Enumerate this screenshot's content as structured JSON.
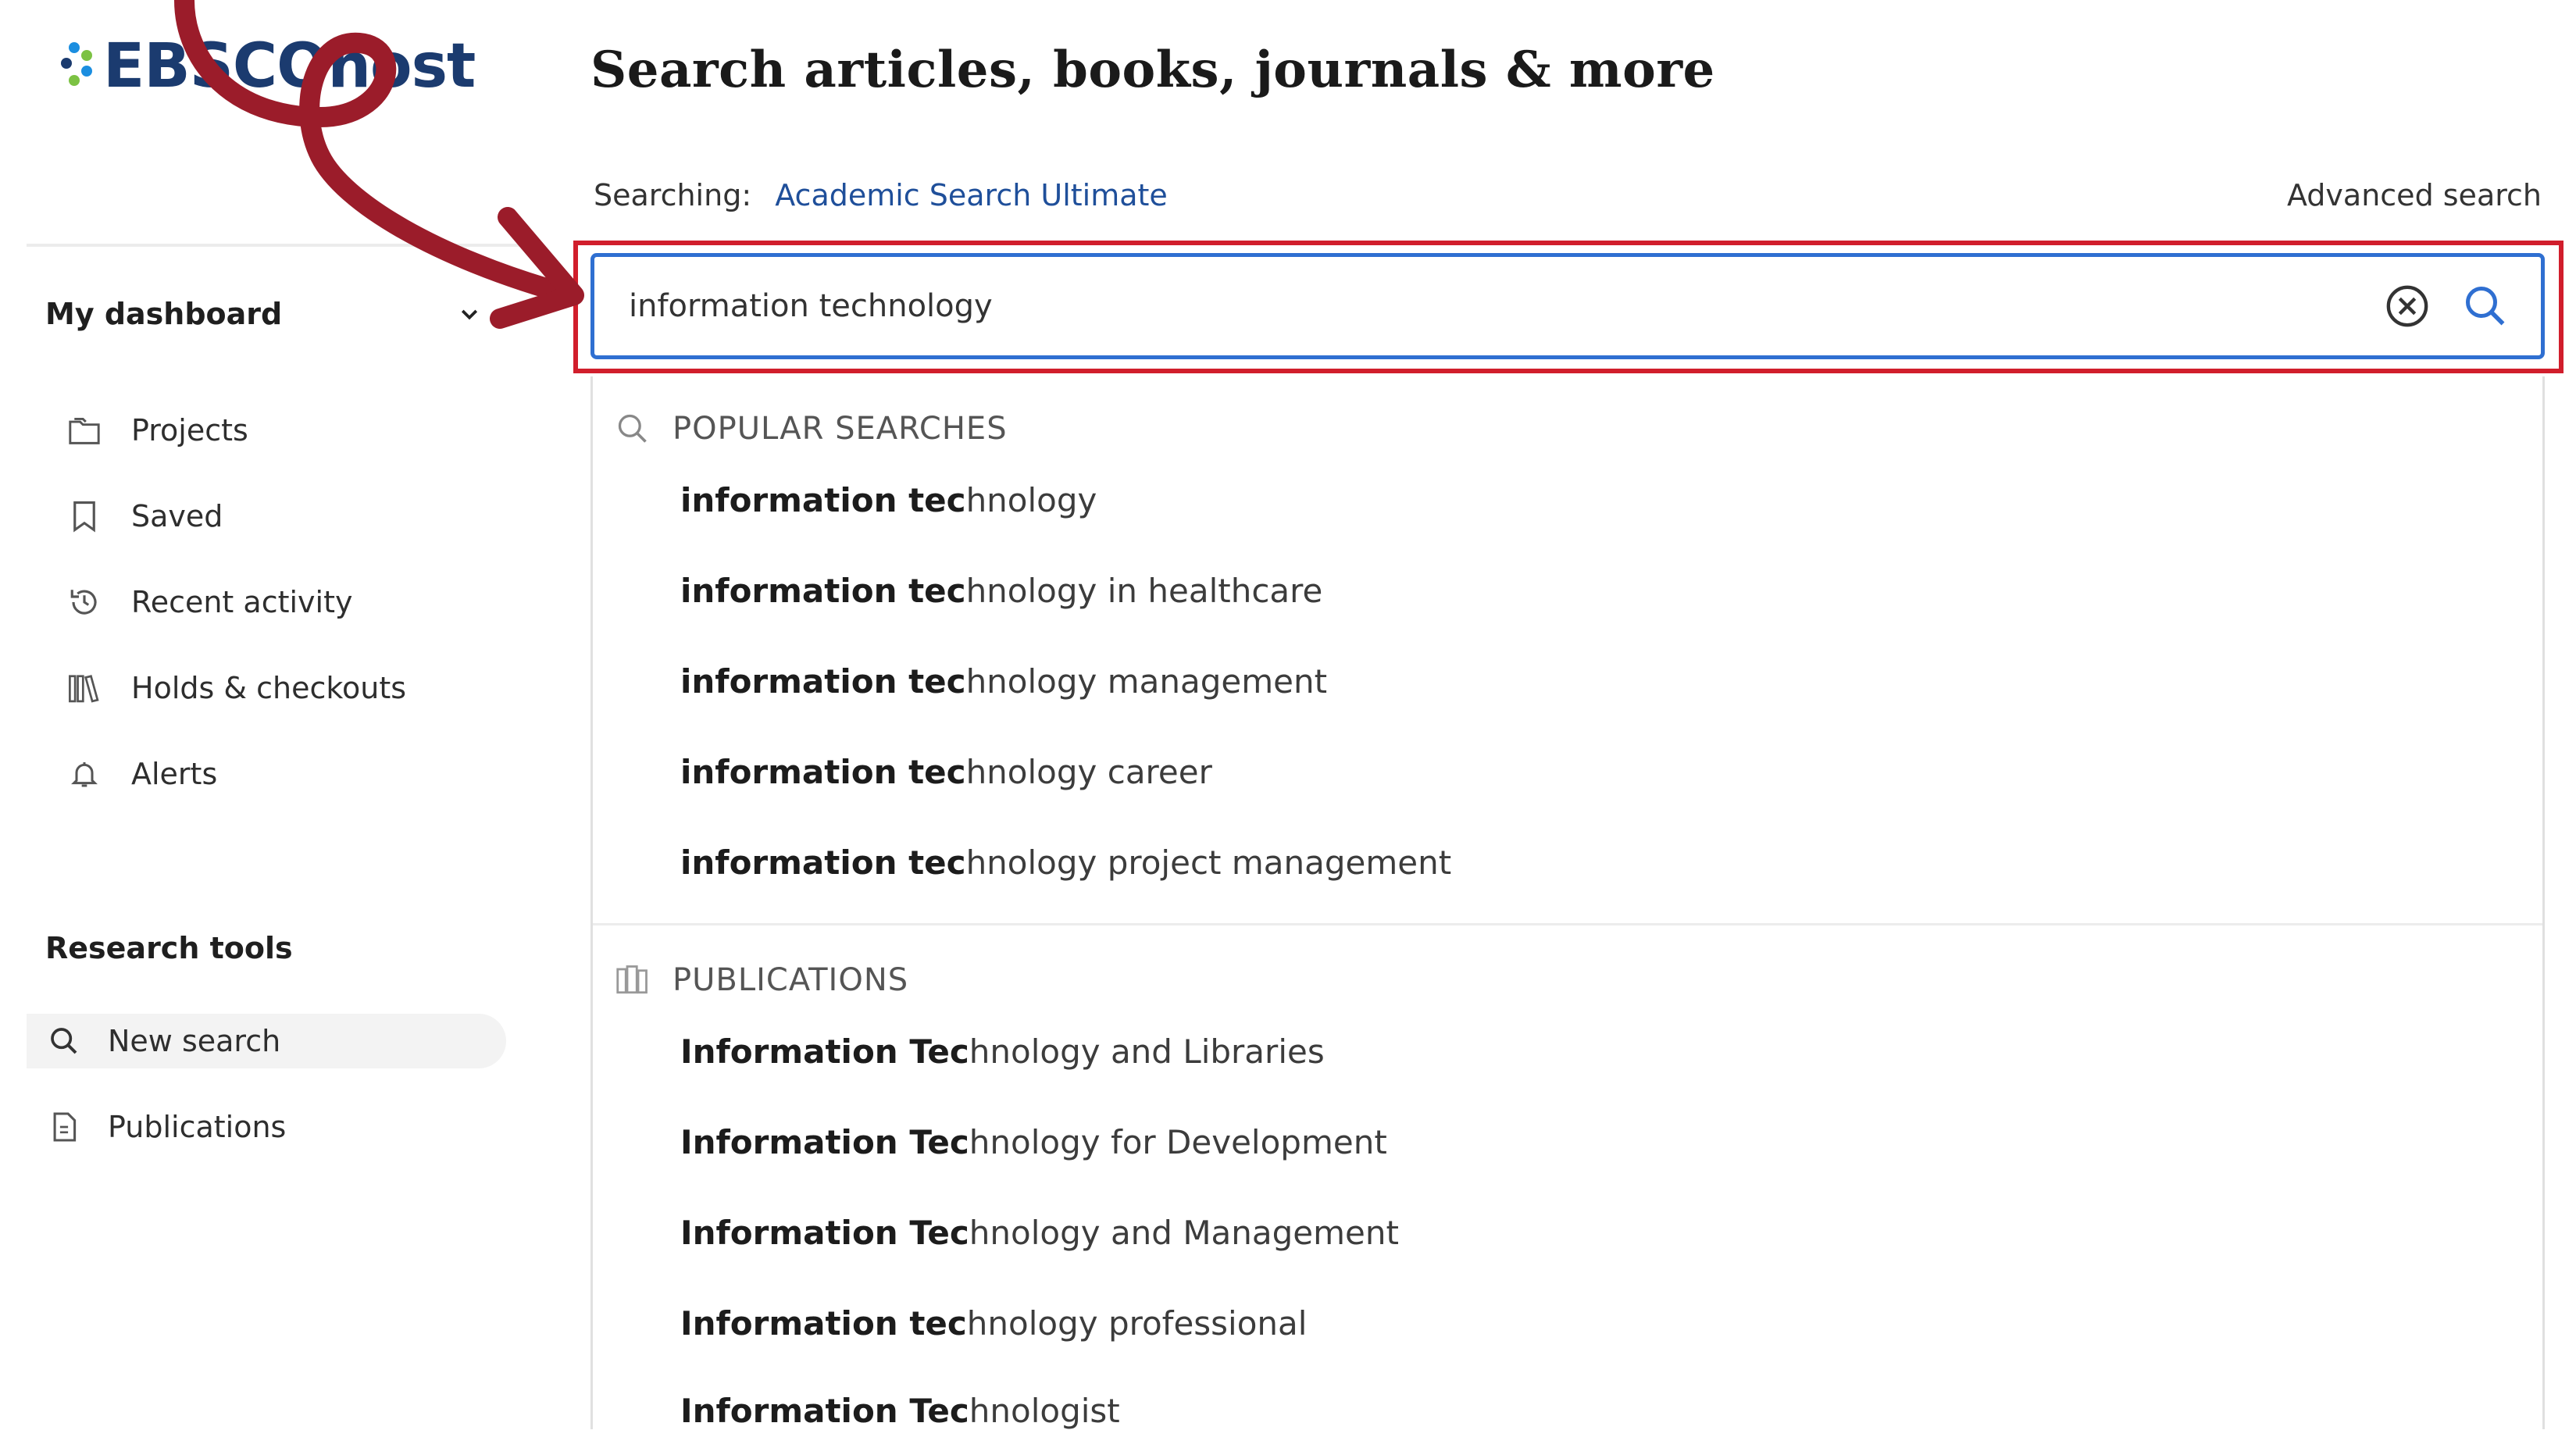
{
  "logo": {
    "text": "EBSCOhost"
  },
  "page": {
    "title": "Search articles, books, journals & more"
  },
  "search": {
    "searching_label": "Searching:",
    "database": "Academic Search Ultimate",
    "advanced_label": "Advanced search",
    "query": "information technology"
  },
  "sidebar": {
    "dashboard_title": "My dashboard",
    "items": [
      {
        "label": "Projects",
        "icon": "projects-icon"
      },
      {
        "label": "Saved",
        "icon": "bookmark-icon"
      },
      {
        "label": "Recent activity",
        "icon": "history-icon"
      },
      {
        "label": "Holds & checkouts",
        "icon": "books-icon"
      },
      {
        "label": "Alerts",
        "icon": "bell-icon"
      }
    ],
    "tools_title": "Research tools",
    "tools": [
      {
        "label": "New search",
        "icon": "search-icon"
      },
      {
        "label": "Publications",
        "icon": "document-icon"
      }
    ]
  },
  "dropdown": {
    "popular_heading": "POPULAR SEARCHES",
    "popular": [
      {
        "bold": "information tec",
        "rest": "hnology"
      },
      {
        "bold": "information tec",
        "rest": "hnology in healthcare"
      },
      {
        "bold": "information tec",
        "rest": "hnology management"
      },
      {
        "bold": "information tec",
        "rest": "hnology career"
      },
      {
        "bold": "information tec",
        "rest": "hnology project management"
      }
    ],
    "publications_heading": "PUBLICATIONS",
    "publications": [
      {
        "bold": "Information Tec",
        "rest": "hnology and Libraries"
      },
      {
        "bold": "Information Tec",
        "rest": "hnology for Development"
      },
      {
        "bold": "Information Tec",
        "rest": "hnology and Management"
      },
      {
        "bold": "Information tec",
        "rest": "hnology professional"
      },
      {
        "bold": "Information Tec",
        "rest": "hnologist"
      }
    ]
  },
  "colors": {
    "brand": "#1b3b6f",
    "accent_link": "#1f4f9a",
    "focus": "#2f6fd1",
    "highlight": "#d11e2c"
  }
}
